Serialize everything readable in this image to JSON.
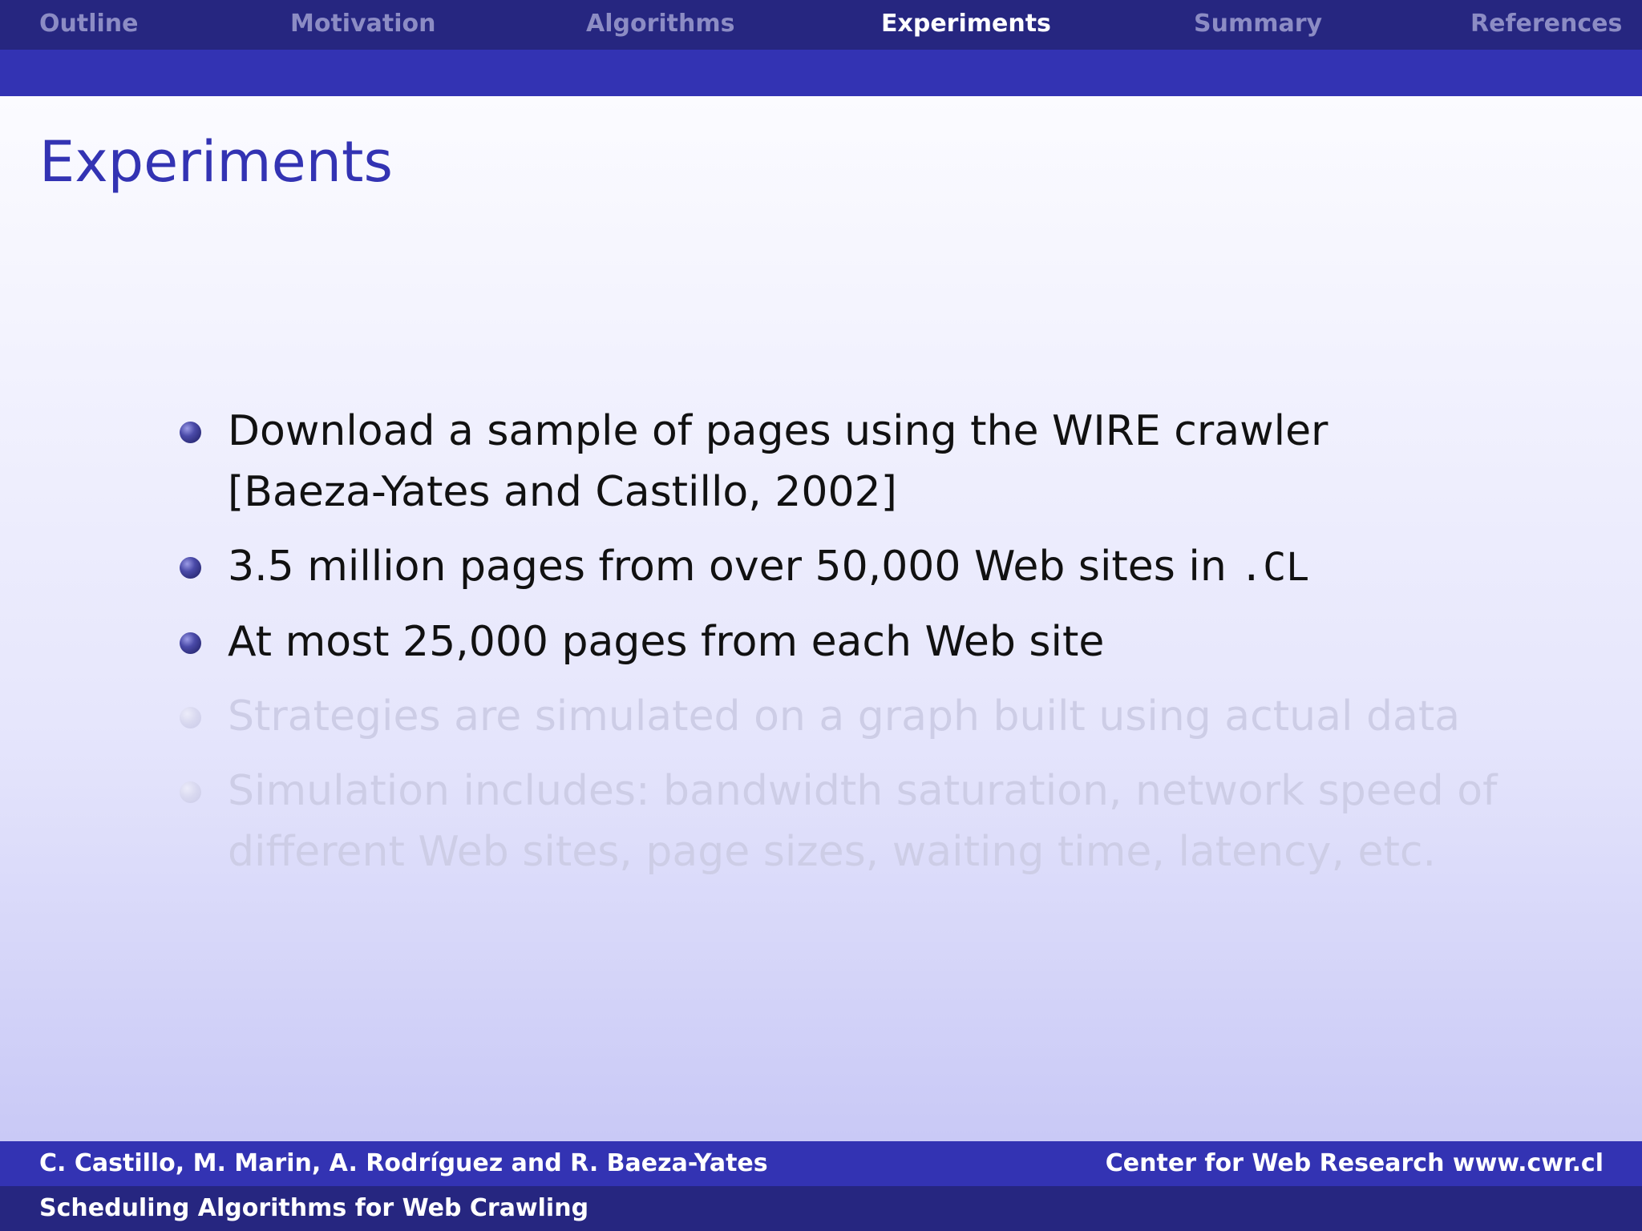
{
  "nav": {
    "items": [
      {
        "label": "Outline"
      },
      {
        "label": "Motivation"
      },
      {
        "label": "Algorithms"
      },
      {
        "label": "Experiments"
      },
      {
        "label": "Summary"
      },
      {
        "label": "References"
      }
    ],
    "active": "Experiments"
  },
  "frame": {
    "title": "Experiments",
    "bullets": [
      {
        "line1": "Download a sample of pages using the WIRE crawler",
        "citation": "[Baeza-Yates and Castillo, 2002]"
      },
      {
        "text": "3.5 million pages from over 50,000 Web sites in",
        "code": ".CL"
      },
      {
        "text": "At most 25,000 pages from each Web site"
      },
      {
        "text": "Strategies are simulated on a graph built using actual data"
      },
      {
        "line1": "Simulation includes: bandwidth saturation, network speed of",
        "line2": "different Web sites, page sizes, waiting time, latency, etc."
      }
    ]
  },
  "footer": {
    "authors": "C. Castillo, M. Marin, A. Rodríguez and R. Baeza-Yates",
    "institute": "Center for Web Research www.cwr.cl",
    "talk_title": "Scheduling Algorithms for Web Crawling"
  },
  "colors": {
    "nav_dark": "#262680",
    "nav_band": "#3333b3",
    "title": "#3333b3",
    "nav_inactive": "#8c8cc4",
    "faded_text": "#cdcde6"
  }
}
